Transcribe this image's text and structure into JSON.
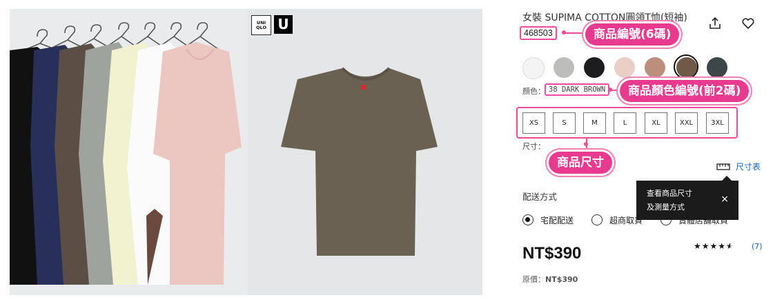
{
  "product": {
    "title": "女裝 SUPIMA COTTON圓領T恤(短袖)",
    "code": "468503",
    "color_label": "顏色：",
    "color_value": "38 DARK BROWN",
    "size_label": "尺寸：",
    "size_chart_label": "尺寸表",
    "sizes": [
      "XS",
      "S",
      "M",
      "L",
      "XL",
      "XXL",
      "3XL"
    ],
    "swatches": [
      "#f4f4f4",
      "#bdbdbb",
      "#1d1d1f",
      "#e9cfc6",
      "#bb8f7c",
      "#6f5a48",
      "#3d4649"
    ],
    "selected_swatch_index": 5,
    "price": "NT$390",
    "original_price_label": "原價：",
    "original_price": "NT$390",
    "rating_stars": 4.5,
    "rating_count": "(7)"
  },
  "shipping": {
    "title": "配送方式",
    "options": [
      "宅配配送",
      "超商取貨",
      "實體店舖取貨"
    ],
    "selected_index": 0
  },
  "tooltip": {
    "line1": "查看商品尺寸",
    "line2": "及測量方式",
    "close": "×"
  },
  "annotations": {
    "code": "商品編號(6碼)",
    "color": "商品顏色編號(前2碼)",
    "size": "商品尺寸"
  },
  "logo": {
    "uniqlo": "UNI QLO",
    "u": "U"
  },
  "colors": {
    "accent_pink": "#e83a8e",
    "link_blue": "#1b5fb3",
    "tshirt": "#6b6152"
  }
}
